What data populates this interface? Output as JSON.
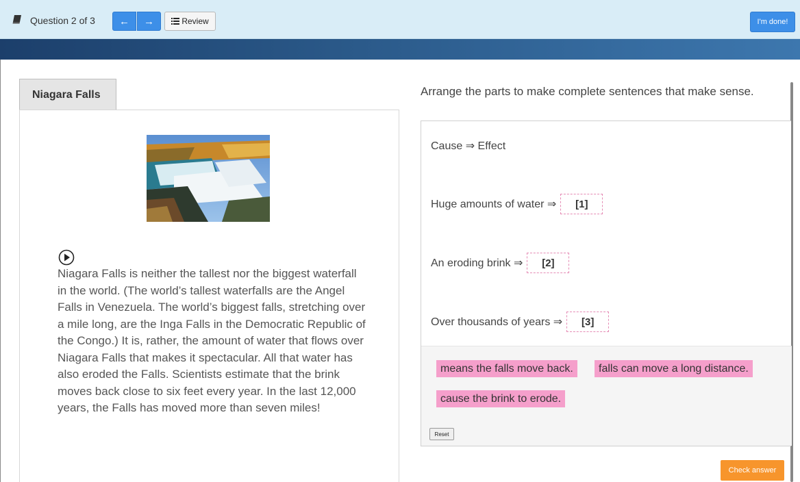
{
  "toolbar": {
    "question_counter": "Question 2 of 3",
    "prev_glyph": "←",
    "next_glyph": "→",
    "review_label": "Review",
    "done_label": "I'm done!",
    "accent_color": "#3d8fe8"
  },
  "passage": {
    "tab_title": "Niagara Falls",
    "image_label": "Niagara Falls photo",
    "text": "Niagara Falls is neither the tallest nor the biggest waterfall in the world. (The world’s tallest waterfalls are the Angel Falls in Venezuela. The world’s biggest falls, stretching over a mile long, are the Inga Falls in the Democratic Republic of the Congo.) It is, rather, the amount of water that flows over Niagara Falls that makes it spectacular. All that water has also eroded the Falls. Scientists estimate that the brink moves back close to six feet every year. In the last 12,000 years, the Falls has moved more than seven miles!"
  },
  "question": {
    "prompt": "Arrange the parts to make complete sentences that make sense.",
    "header": "Cause ⇒ Effect",
    "rows": [
      {
        "cause": "Huge amounts of water ⇒",
        "slot": "[1]"
      },
      {
        "cause": "An eroding brink ⇒",
        "slot": "[2]"
      },
      {
        "cause": "Over thousands of years ⇒",
        "slot": "[3]"
      }
    ],
    "options": [
      "means the falls move back.",
      "falls can move a long distance.",
      "cause the brink to erode."
    ],
    "reset_label": "Reset",
    "check_label": "Check answer",
    "option_color": "#f59fcb",
    "check_color": "#f7952c"
  }
}
